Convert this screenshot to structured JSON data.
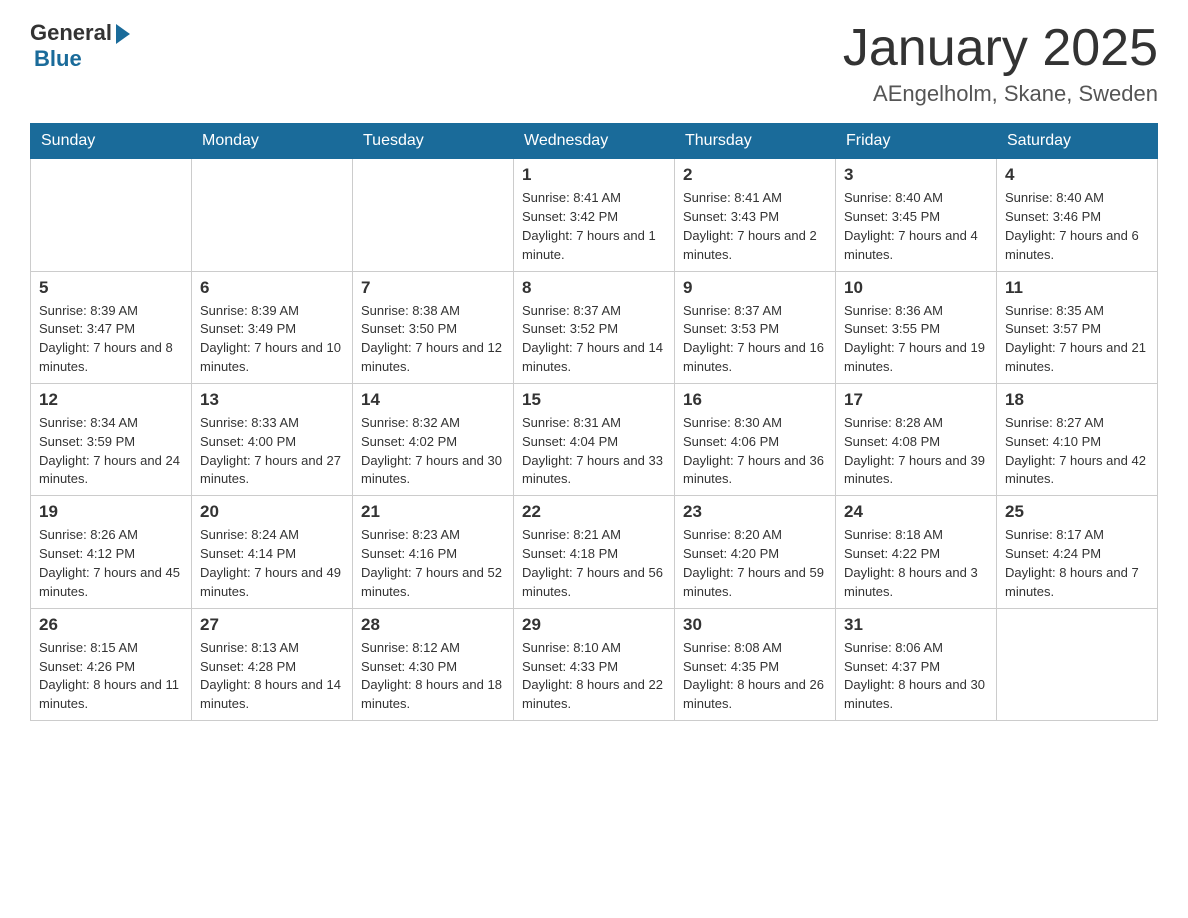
{
  "header": {
    "logo": {
      "general": "General",
      "blue": "Blue"
    },
    "title": "January 2025",
    "subtitle": "AEngelholm, Skane, Sweden"
  },
  "days_of_week": [
    "Sunday",
    "Monday",
    "Tuesday",
    "Wednesday",
    "Thursday",
    "Friday",
    "Saturday"
  ],
  "weeks": [
    [
      {
        "day": "",
        "info": ""
      },
      {
        "day": "",
        "info": ""
      },
      {
        "day": "",
        "info": ""
      },
      {
        "day": "1",
        "info": "Sunrise: 8:41 AM\nSunset: 3:42 PM\nDaylight: 7 hours and 1 minute."
      },
      {
        "day": "2",
        "info": "Sunrise: 8:41 AM\nSunset: 3:43 PM\nDaylight: 7 hours and 2 minutes."
      },
      {
        "day": "3",
        "info": "Sunrise: 8:40 AM\nSunset: 3:45 PM\nDaylight: 7 hours and 4 minutes."
      },
      {
        "day": "4",
        "info": "Sunrise: 8:40 AM\nSunset: 3:46 PM\nDaylight: 7 hours and 6 minutes."
      }
    ],
    [
      {
        "day": "5",
        "info": "Sunrise: 8:39 AM\nSunset: 3:47 PM\nDaylight: 7 hours and 8 minutes."
      },
      {
        "day": "6",
        "info": "Sunrise: 8:39 AM\nSunset: 3:49 PM\nDaylight: 7 hours and 10 minutes."
      },
      {
        "day": "7",
        "info": "Sunrise: 8:38 AM\nSunset: 3:50 PM\nDaylight: 7 hours and 12 minutes."
      },
      {
        "day": "8",
        "info": "Sunrise: 8:37 AM\nSunset: 3:52 PM\nDaylight: 7 hours and 14 minutes."
      },
      {
        "day": "9",
        "info": "Sunrise: 8:37 AM\nSunset: 3:53 PM\nDaylight: 7 hours and 16 minutes."
      },
      {
        "day": "10",
        "info": "Sunrise: 8:36 AM\nSunset: 3:55 PM\nDaylight: 7 hours and 19 minutes."
      },
      {
        "day": "11",
        "info": "Sunrise: 8:35 AM\nSunset: 3:57 PM\nDaylight: 7 hours and 21 minutes."
      }
    ],
    [
      {
        "day": "12",
        "info": "Sunrise: 8:34 AM\nSunset: 3:59 PM\nDaylight: 7 hours and 24 minutes."
      },
      {
        "day": "13",
        "info": "Sunrise: 8:33 AM\nSunset: 4:00 PM\nDaylight: 7 hours and 27 minutes."
      },
      {
        "day": "14",
        "info": "Sunrise: 8:32 AM\nSunset: 4:02 PM\nDaylight: 7 hours and 30 minutes."
      },
      {
        "day": "15",
        "info": "Sunrise: 8:31 AM\nSunset: 4:04 PM\nDaylight: 7 hours and 33 minutes."
      },
      {
        "day": "16",
        "info": "Sunrise: 8:30 AM\nSunset: 4:06 PM\nDaylight: 7 hours and 36 minutes."
      },
      {
        "day": "17",
        "info": "Sunrise: 8:28 AM\nSunset: 4:08 PM\nDaylight: 7 hours and 39 minutes."
      },
      {
        "day": "18",
        "info": "Sunrise: 8:27 AM\nSunset: 4:10 PM\nDaylight: 7 hours and 42 minutes."
      }
    ],
    [
      {
        "day": "19",
        "info": "Sunrise: 8:26 AM\nSunset: 4:12 PM\nDaylight: 7 hours and 45 minutes."
      },
      {
        "day": "20",
        "info": "Sunrise: 8:24 AM\nSunset: 4:14 PM\nDaylight: 7 hours and 49 minutes."
      },
      {
        "day": "21",
        "info": "Sunrise: 8:23 AM\nSunset: 4:16 PM\nDaylight: 7 hours and 52 minutes."
      },
      {
        "day": "22",
        "info": "Sunrise: 8:21 AM\nSunset: 4:18 PM\nDaylight: 7 hours and 56 minutes."
      },
      {
        "day": "23",
        "info": "Sunrise: 8:20 AM\nSunset: 4:20 PM\nDaylight: 7 hours and 59 minutes."
      },
      {
        "day": "24",
        "info": "Sunrise: 8:18 AM\nSunset: 4:22 PM\nDaylight: 8 hours and 3 minutes."
      },
      {
        "day": "25",
        "info": "Sunrise: 8:17 AM\nSunset: 4:24 PM\nDaylight: 8 hours and 7 minutes."
      }
    ],
    [
      {
        "day": "26",
        "info": "Sunrise: 8:15 AM\nSunset: 4:26 PM\nDaylight: 8 hours and 11 minutes."
      },
      {
        "day": "27",
        "info": "Sunrise: 8:13 AM\nSunset: 4:28 PM\nDaylight: 8 hours and 14 minutes."
      },
      {
        "day": "28",
        "info": "Sunrise: 8:12 AM\nSunset: 4:30 PM\nDaylight: 8 hours and 18 minutes."
      },
      {
        "day": "29",
        "info": "Sunrise: 8:10 AM\nSunset: 4:33 PM\nDaylight: 8 hours and 22 minutes."
      },
      {
        "day": "30",
        "info": "Sunrise: 8:08 AM\nSunset: 4:35 PM\nDaylight: 8 hours and 26 minutes."
      },
      {
        "day": "31",
        "info": "Sunrise: 8:06 AM\nSunset: 4:37 PM\nDaylight: 8 hours and 30 minutes."
      },
      {
        "day": "",
        "info": ""
      }
    ]
  ]
}
